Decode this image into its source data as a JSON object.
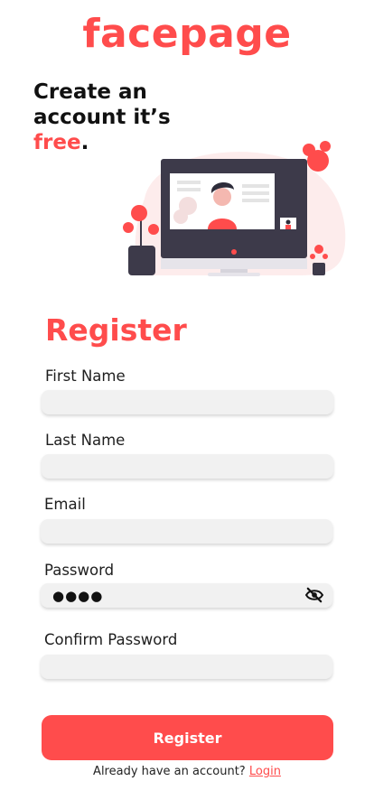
{
  "colors": {
    "accent": "#ff4c4c",
    "input_bg": "#f1f1f1",
    "monitor": "#3d3a4a"
  },
  "brand": {
    "logo_text": "facepage"
  },
  "hero": {
    "line1": "Create an",
    "line2": "account it’s",
    "free_word": "free",
    "period": "."
  },
  "form": {
    "title": "Register",
    "first_name_label": "First Name",
    "last_name_label": "Last Name",
    "email_label": "Email",
    "password_label": "Password",
    "password_mask": "●●●●",
    "confirm_password_label": "Confirm Password"
  },
  "icons": {
    "password_toggle": "eye-slash-icon"
  },
  "actions": {
    "register_label": "Register"
  },
  "footer": {
    "prompt": "Already have an account?",
    "login_link": "Login"
  }
}
